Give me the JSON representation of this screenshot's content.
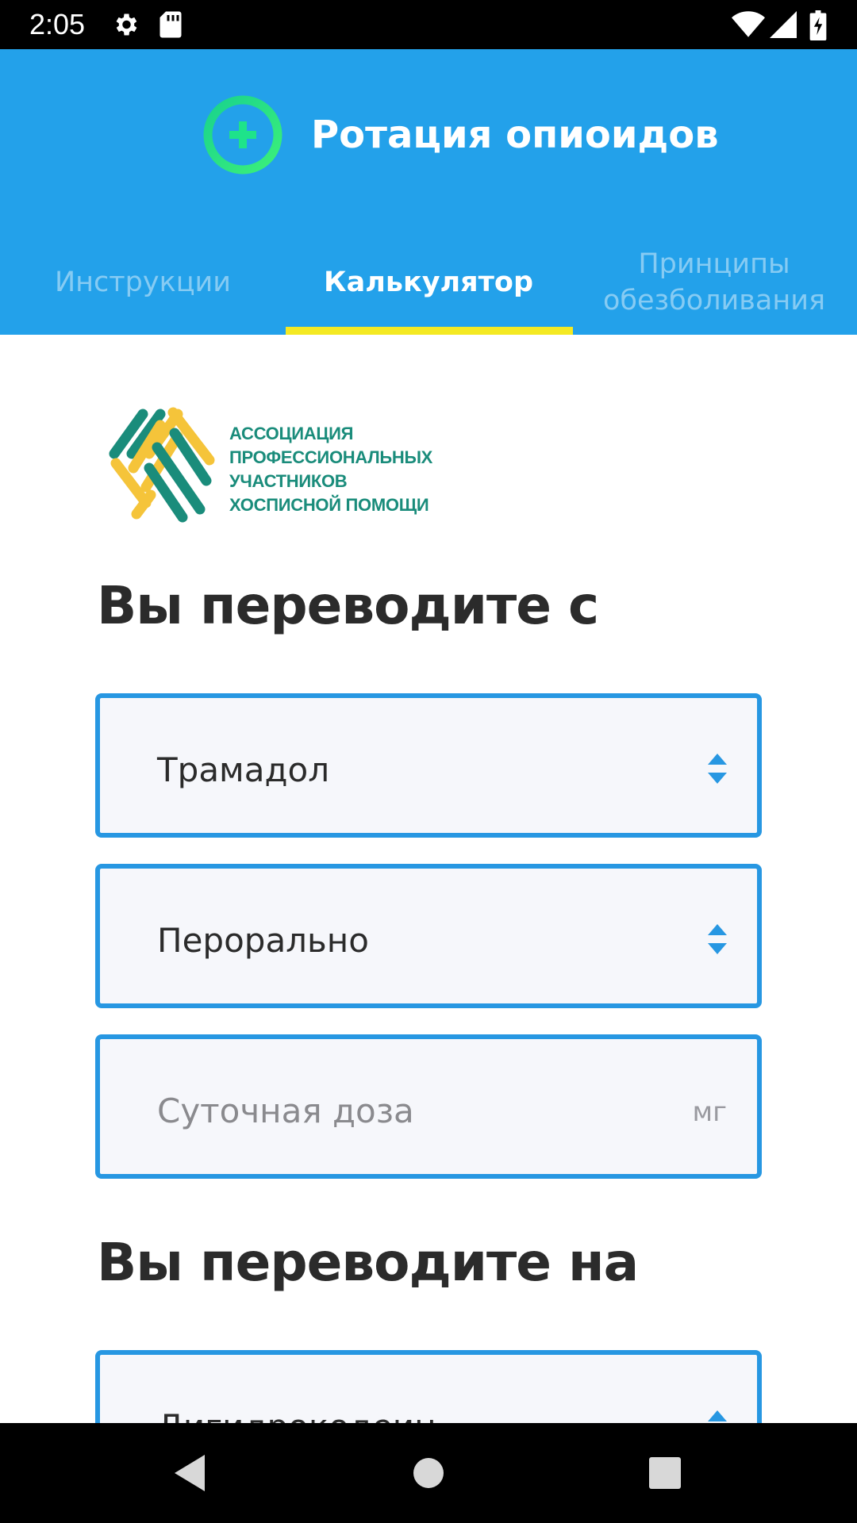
{
  "status_bar": {
    "time": "2:05",
    "icons": [
      "gear-icon",
      "sd-card-icon",
      "wifi-icon",
      "signal-icon",
      "battery-charging-icon"
    ]
  },
  "header": {
    "title": "Ротация опиоидов",
    "logo_icon": "plus-circle-icon",
    "colors": {
      "background": "#23a1ea",
      "logo": "#1ee38a",
      "indicator": "#f4e923"
    }
  },
  "tabs": [
    {
      "label": "Инструкции",
      "active": false
    },
    {
      "label": "Калькулятор",
      "active": true
    },
    {
      "label": "Принципы обезболивания",
      "active": false
    }
  ],
  "org": {
    "lines": [
      "АССОЦИАЦИЯ",
      "ПРОФЕССИОНАЛЬНЫХ",
      "УЧАСТНИКОВ",
      "ХОСПИСНОЙ ПОМОЩИ"
    ],
    "colors": {
      "teal": "#1a8c7b",
      "yellow": "#f5c43a"
    }
  },
  "from": {
    "heading": "Вы переводите с",
    "drug": "Трамадол",
    "route": "Перорально",
    "dose_placeholder": "Суточная доза",
    "dose_unit": "мг"
  },
  "to": {
    "heading": "Вы переводите на",
    "drug": "Дигидрокодеин"
  },
  "nav": {
    "back_icon": "back-triangle-icon",
    "home_icon": "home-circle-icon",
    "recents_icon": "recents-square-icon"
  }
}
